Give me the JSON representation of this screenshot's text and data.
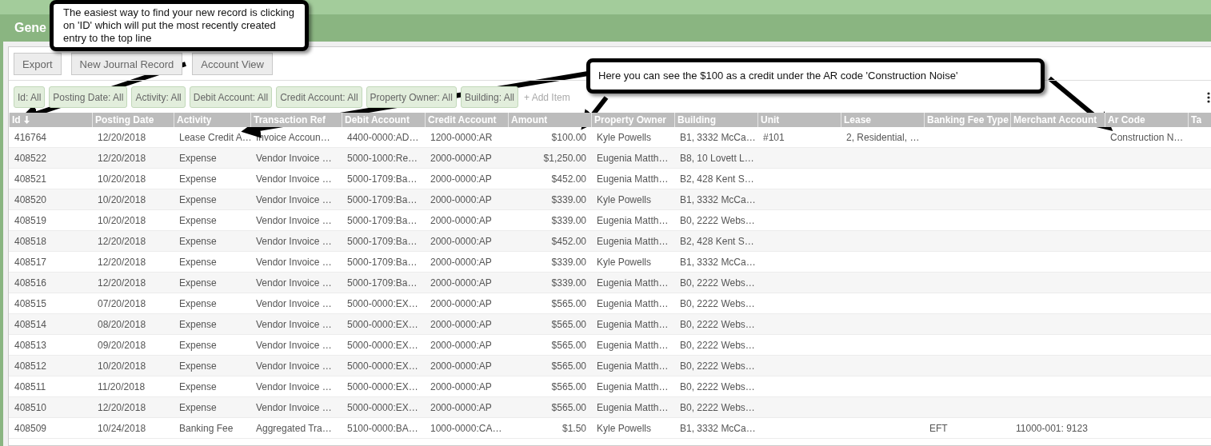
{
  "panel": {
    "title": "Gene"
  },
  "toolbar": {
    "buttons": [
      "Export",
      "New Journal Record",
      "Account View"
    ]
  },
  "filters": {
    "chips": [
      "Id: All",
      "Posting Date: All",
      "Activity: All",
      "Debit Account: All",
      "Credit Account: All",
      "Property Owner: All",
      "Building: All"
    ],
    "add_item": "+ Add Item"
  },
  "table": {
    "columns": [
      {
        "label": "Id",
        "sorted": true
      },
      {
        "label": "Posting Date",
        "sorted": false
      },
      {
        "label": "Activity",
        "sorted": false
      },
      {
        "label": "Transaction Ref",
        "sorted": false
      },
      {
        "label": "Debit Account",
        "sorted": false
      },
      {
        "label": "Credit Account",
        "sorted": false
      },
      {
        "label": "Amount",
        "sorted": false
      },
      {
        "label": "Property Owner",
        "sorted": false
      },
      {
        "label": "Building",
        "sorted": false
      },
      {
        "label": "Unit",
        "sorted": false
      },
      {
        "label": "Lease",
        "sorted": false
      },
      {
        "label": "Banking Fee Type",
        "sorted": false
      },
      {
        "label": "Merchant Account",
        "sorted": false
      },
      {
        "label": "Ar Code",
        "sorted": false
      },
      {
        "label": "Ta",
        "sorted": false
      }
    ],
    "rows": [
      {
        "id": "416764",
        "date": "12/20/2018",
        "activity": "Lease Credit A…",
        "ref": "Invoice Accoun…",
        "debit": "4400-0000:AD…",
        "credit": "1200-0000:AR",
        "amount": "$100.00",
        "owner": "Kyle Powells",
        "building": "B1, 3332 McCa…",
        "unit": "#101",
        "lease": "2, Residential, …",
        "ar_code": "Construction N…"
      },
      {
        "id": "408522",
        "date": "12/20/2018",
        "activity": "Expense",
        "ref": "Vendor Invoice …",
        "debit": "5000-1000:Re…",
        "credit": "2000-0000:AP",
        "amount": "$1,250.00",
        "owner": "Eugenia Matth…",
        "building": "B8, 10 Lovett L…"
      },
      {
        "id": "408521",
        "date": "10/20/2018",
        "activity": "Expense",
        "ref": "Vendor Invoice …",
        "debit": "5000-1709:Ba…",
        "credit": "2000-0000:AP",
        "amount": "$452.00",
        "owner": "Eugenia Matth…",
        "building": "B2, 428 Kent S…"
      },
      {
        "id": "408520",
        "date": "10/20/2018",
        "activity": "Expense",
        "ref": "Vendor Invoice …",
        "debit": "5000-1709:Ba…",
        "credit": "2000-0000:AP",
        "amount": "$339.00",
        "owner": "Kyle Powells",
        "building": "B1, 3332 McCa…"
      },
      {
        "id": "408519",
        "date": "10/20/2018",
        "activity": "Expense",
        "ref": "Vendor Invoice …",
        "debit": "5000-1709:Ba…",
        "credit": "2000-0000:AP",
        "amount": "$339.00",
        "owner": "Eugenia Matth…",
        "building": "B0, 2222 Webs…"
      },
      {
        "id": "408518",
        "date": "12/20/2018",
        "activity": "Expense",
        "ref": "Vendor Invoice …",
        "debit": "5000-1709:Ba…",
        "credit": "2000-0000:AP",
        "amount": "$452.00",
        "owner": "Eugenia Matth…",
        "building": "B2, 428 Kent S…"
      },
      {
        "id": "408517",
        "date": "12/20/2018",
        "activity": "Expense",
        "ref": "Vendor Invoice …",
        "debit": "5000-1709:Ba…",
        "credit": "2000-0000:AP",
        "amount": "$339.00",
        "owner": "Kyle Powells",
        "building": "B1, 3332 McCa…"
      },
      {
        "id": "408516",
        "date": "12/20/2018",
        "activity": "Expense",
        "ref": "Vendor Invoice …",
        "debit": "5000-1709:Ba…",
        "credit": "2000-0000:AP",
        "amount": "$339.00",
        "owner": "Eugenia Matth…",
        "building": "B0, 2222 Webs…"
      },
      {
        "id": "408515",
        "date": "07/20/2018",
        "activity": "Expense",
        "ref": "Vendor Invoice …",
        "debit": "5000-0000:EX…",
        "credit": "2000-0000:AP",
        "amount": "$565.00",
        "owner": "Eugenia Matth…",
        "building": "B0, 2222 Webs…"
      },
      {
        "id": "408514",
        "date": "08/20/2018",
        "activity": "Expense",
        "ref": "Vendor Invoice …",
        "debit": "5000-0000:EX…",
        "credit": "2000-0000:AP",
        "amount": "$565.00",
        "owner": "Eugenia Matth…",
        "building": "B0, 2222 Webs…"
      },
      {
        "id": "408513",
        "date": "09/20/2018",
        "activity": "Expense",
        "ref": "Vendor Invoice …",
        "debit": "5000-0000:EX…",
        "credit": "2000-0000:AP",
        "amount": "$565.00",
        "owner": "Eugenia Matth…",
        "building": "B0, 2222 Webs…"
      },
      {
        "id": "408512",
        "date": "10/20/2018",
        "activity": "Expense",
        "ref": "Vendor Invoice …",
        "debit": "5000-0000:EX…",
        "credit": "2000-0000:AP",
        "amount": "$565.00",
        "owner": "Eugenia Matth…",
        "building": "B0, 2222 Webs…"
      },
      {
        "id": "408511",
        "date": "11/20/2018",
        "activity": "Expense",
        "ref": "Vendor Invoice …",
        "debit": "5000-0000:EX…",
        "credit": "2000-0000:AP",
        "amount": "$565.00",
        "owner": "Eugenia Matth…",
        "building": "B0, 2222 Webs…"
      },
      {
        "id": "408510",
        "date": "12/20/2018",
        "activity": "Expense",
        "ref": "Vendor Invoice …",
        "debit": "5000-0000:EX…",
        "credit": "2000-0000:AP",
        "amount": "$565.00",
        "owner": "Eugenia Matth…",
        "building": "B0, 2222 Webs…"
      },
      {
        "id": "408509",
        "date": "10/24/2018",
        "activity": "Banking Fee",
        "ref": "Aggregated Tra…",
        "debit": "5100-0000:BA…",
        "credit": "1000-0000:CA…",
        "amount": "$1.50",
        "owner": "Kyle Powells",
        "building": "B1, 3332 McCa…",
        "fee_type": "EFT",
        "merchant": "11000-001: 9123"
      }
    ]
  },
  "callouts": [
    {
      "text": "The easiest way to find your new record is clicking on 'ID' which will put the most recently created entry to the top line"
    },
    {
      "text": "Here you can see the $100 as a credit under the AR code 'Construction Noise'"
    }
  ]
}
